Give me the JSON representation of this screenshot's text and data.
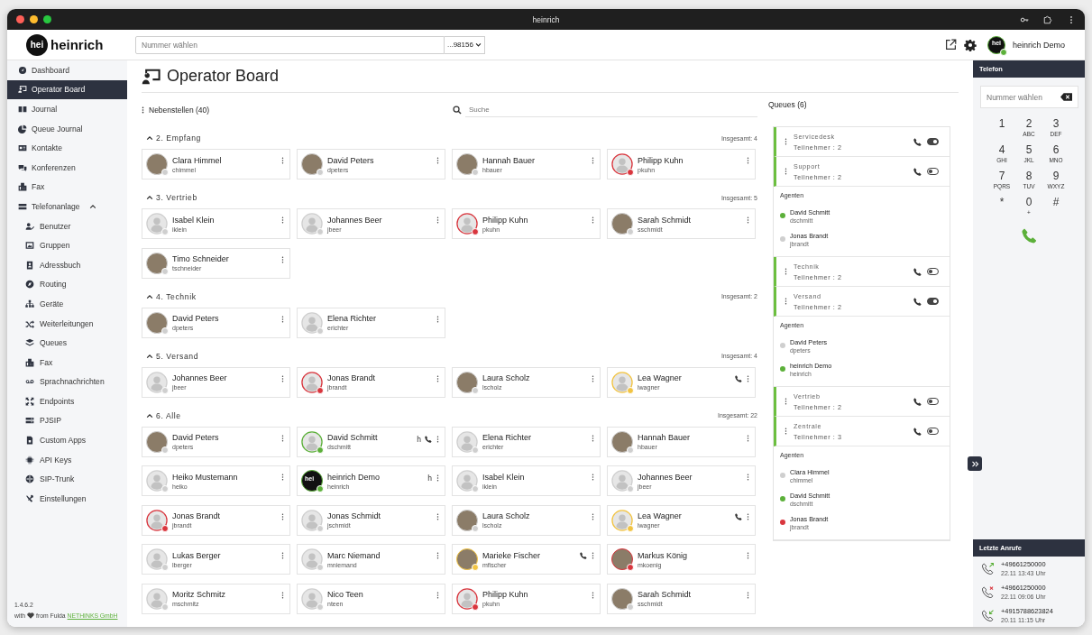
{
  "window": {
    "title": "heinrich"
  },
  "header": {
    "logo_mark": "hei",
    "logo_text": "heinrich",
    "dial_placeholder": "Nummer wählen",
    "caller_id": "...98156",
    "user": {
      "name": "heinrich Demo",
      "avatar_text": "hei",
      "color": "#5cb03a"
    }
  },
  "sidebar": {
    "items": [
      {
        "label": "Dashboard",
        "selected": false
      },
      {
        "label": "Operator Board",
        "selected": true
      },
      {
        "label": "Journal",
        "selected": false
      },
      {
        "label": "Queue Journal",
        "selected": false
      },
      {
        "label": "Kontakte",
        "selected": false
      },
      {
        "label": "Konferenzen",
        "selected": false
      },
      {
        "label": "Fax",
        "selected": false
      },
      {
        "label": "Telefonanlage",
        "selected": false,
        "expanded": true,
        "children": [
          {
            "label": "Benutzer",
            "selected": false
          },
          {
            "label": "Gruppen",
            "selected": false
          },
          {
            "label": "Adressbuch",
            "selected": false
          },
          {
            "label": "Routing",
            "selected": false
          },
          {
            "label": "Geräte",
            "selected": false
          },
          {
            "label": "Weiterleitungen",
            "selected": false
          },
          {
            "label": "Queues",
            "selected": false
          },
          {
            "label": "Fax",
            "selected": false
          },
          {
            "label": "Sprachnachrichten",
            "selected": false
          },
          {
            "label": "Endpoints",
            "selected": false
          },
          {
            "label": "PJSIP",
            "selected": false
          },
          {
            "label": "Custom Apps",
            "selected": false
          },
          {
            "label": "API Keys",
            "selected": false
          },
          {
            "label": "SIP-Trunk",
            "selected": false
          },
          {
            "label": "Einstellungen",
            "selected": false
          }
        ]
      }
    ],
    "version": "1.4.6.2",
    "credit": {
      "before": "with",
      "after": "from Fulda",
      "link": "NETHINKS GmbH"
    }
  },
  "page": {
    "title": "Operator Board"
  },
  "extensions": {
    "title": "Nebenstellen (40)",
    "search_placeholder": "Suche",
    "groups": [
      {
        "title": "2. Empfang",
        "total": "Insgesamt: 4",
        "expanded": true,
        "items": [
          {
            "name": "Clara Himmel",
            "user": "chimmel",
            "kind": "photo",
            "color": "#cfcfcf",
            "calling": false
          },
          {
            "name": "David Peters",
            "user": "dpeters",
            "kind": "photo",
            "color": "#cfcfcf",
            "calling": false
          },
          {
            "name": "Hannah Bauer",
            "user": "hbauer",
            "kind": "photo",
            "color": "#cfcfcf",
            "calling": false
          },
          {
            "name": "Philipp Kuhn",
            "user": "pkuhn",
            "kind": "default",
            "color": "#d9363e",
            "calling": false
          }
        ]
      },
      {
        "title": "3. Vertrieb",
        "total": "Insgesamt: 5",
        "expanded": true,
        "items": [
          {
            "name": "Isabel Klein",
            "user": "iklein",
            "kind": "default",
            "color": "#cfcfcf",
            "calling": false
          },
          {
            "name": "Johannes Beer",
            "user": "jbeer",
            "kind": "default",
            "color": "#cfcfcf",
            "calling": false
          },
          {
            "name": "Philipp Kuhn",
            "user": "pkuhn",
            "kind": "default",
            "color": "#d9363e",
            "calling": false
          },
          {
            "name": "Sarah Schmidt",
            "user": "sschmidt",
            "kind": "photo",
            "color": "#cfcfcf",
            "calling": false
          },
          {
            "name": "Timo Schneider",
            "user": "tschneider",
            "kind": "photo",
            "color": "#cfcfcf",
            "calling": false
          }
        ]
      },
      {
        "title": "4. Technik",
        "total": "Insgesamt: 2",
        "expanded": true,
        "items": [
          {
            "name": "David Peters",
            "user": "dpeters",
            "kind": "photo",
            "color": "#cfcfcf",
            "calling": false
          },
          {
            "name": "Elena Richter",
            "user": "erichter",
            "kind": "default",
            "color": "#cfcfcf",
            "calling": false
          }
        ]
      },
      {
        "title": "5. Versand",
        "total": "Insgesamt: 4",
        "expanded": true,
        "items": [
          {
            "name": "Johannes Beer",
            "user": "jbeer",
            "kind": "default",
            "color": "#cfcfcf",
            "calling": false
          },
          {
            "name": "Jonas Brandt",
            "user": "jbrandt",
            "kind": "default",
            "color": "#d9363e",
            "calling": false
          },
          {
            "name": "Laura Scholz",
            "user": "lscholz",
            "kind": "photo",
            "color": "#cfcfcf",
            "calling": false
          },
          {
            "name": "Lea Wagner",
            "user": "lwagner",
            "kind": "default",
            "color": "#f2c443",
            "calling": true
          }
        ]
      },
      {
        "title": "6. Alle",
        "total": "Insgesamt: 22",
        "expanded": true,
        "items": [
          {
            "name": "David Peters",
            "user": "dpeters",
            "kind": "photo",
            "color": "#cfcfcf",
            "calling": false
          },
          {
            "name": "David Schmitt",
            "user": "dschmitt",
            "kind": "default",
            "color": "#5cb03a",
            "flag": "h",
            "calling": true
          },
          {
            "name": "Elena Richter",
            "user": "erichter",
            "kind": "default",
            "color": "#cfcfcf",
            "calling": false
          },
          {
            "name": "Hannah Bauer",
            "user": "hbauer",
            "kind": "photo",
            "color": "#cfcfcf",
            "calling": false
          },
          {
            "name": "Heiko Mustemann",
            "user": "heiko",
            "kind": "default",
            "color": "#cfcfcf",
            "calling": false
          },
          {
            "name": "heinrich Demo",
            "user": "heinrich",
            "kind": "logo",
            "avatar_text": "hei",
            "color": "#5cb03a",
            "flag": "h",
            "calling": false
          },
          {
            "name": "Isabel Klein",
            "user": "iklein",
            "kind": "default",
            "color": "#cfcfcf",
            "calling": false
          },
          {
            "name": "Johannes Beer",
            "user": "jbeer",
            "kind": "default",
            "color": "#cfcfcf",
            "calling": false
          },
          {
            "name": "Jonas Brandt",
            "user": "jbrandt",
            "kind": "default",
            "color": "#d9363e",
            "calling": false
          },
          {
            "name": "Jonas Schmidt",
            "user": "jschmidt",
            "kind": "default",
            "color": "#cfcfcf",
            "calling": false
          },
          {
            "name": "Laura Scholz",
            "user": "lscholz",
            "kind": "photo",
            "color": "#cfcfcf",
            "calling": false
          },
          {
            "name": "Lea Wagner",
            "user": "lwagner",
            "kind": "default",
            "color": "#f2c443",
            "calling": true
          },
          {
            "name": "Lukas Berger",
            "user": "lberger",
            "kind": "default",
            "color": "#cfcfcf",
            "calling": false
          },
          {
            "name": "Marc Niemand",
            "user": "mniemand",
            "kind": "default",
            "color": "#cfcfcf",
            "calling": false
          },
          {
            "name": "Marieke Fischer",
            "user": "mfischer",
            "kind": "photo",
            "color": "#f2c443",
            "calling": true
          },
          {
            "name": "Markus König",
            "user": "mkoenig",
            "kind": "photo",
            "color": "#d9363e",
            "calling": false
          },
          {
            "name": "Moritz Schmitz",
            "user": "mschmitz",
            "kind": "default",
            "color": "#cfcfcf",
            "calling": false
          },
          {
            "name": "Nico Teen",
            "user": "nteen",
            "kind": "default",
            "color": "#cfcfcf",
            "calling": false
          },
          {
            "name": "Philipp Kuhn",
            "user": "pkuhn",
            "kind": "default",
            "color": "#d9363e",
            "calling": false
          },
          {
            "name": "Sarah Schmidt",
            "user": "sschmidt",
            "kind": "photo",
            "color": "#cfcfcf",
            "calling": false
          }
        ]
      }
    ]
  },
  "queues": {
    "title": "Queues (6)",
    "items": [
      {
        "name": "Servicedesk",
        "members": "Teilnehmer : 2",
        "active": true
      },
      {
        "name": "Support",
        "members": "Teilnehmer : 2",
        "active": false,
        "agents_label": "Agenten",
        "agents": [
          {
            "name": "David Schmitt",
            "user": "dschmitt",
            "color": "#5cb03a"
          },
          {
            "name": "Jonas Brandt",
            "user": "jbrandt",
            "color": "#cfcfcf"
          }
        ]
      },
      {
        "name": "Technik",
        "members": "Teilnehmer : 2",
        "active": false
      },
      {
        "name": "Versand",
        "members": "Teilnehmer : 2",
        "active": true,
        "agents_label": "Agenten",
        "agents": [
          {
            "name": "David Peters",
            "user": "dpeters",
            "color": "#cfcfcf"
          },
          {
            "name": "heinrich Demo",
            "user": "heinrich",
            "color": "#5cb03a"
          }
        ]
      },
      {
        "name": "Vertrieb",
        "members": "Teilnehmer : 2",
        "active": false
      },
      {
        "name": "Zentrale",
        "members": "Teilnehmer : 3",
        "active": false,
        "agents_label": "Agenten",
        "agents": [
          {
            "name": "Clara Himmel",
            "user": "chimmel",
            "color": "#cfcfcf"
          },
          {
            "name": "David Schmitt",
            "user": "dschmitt",
            "color": "#5cb03a"
          },
          {
            "name": "Jonas Brandt",
            "user": "jbrandt",
            "color": "#d9363e"
          }
        ]
      }
    ]
  },
  "phone": {
    "title": "Telefon",
    "placeholder": "Nummer wählen",
    "keys": [
      {
        "digit": "1"
      },
      {
        "digit": "2",
        "letters": "ABC"
      },
      {
        "digit": "3",
        "letters": "DEF"
      },
      {
        "digit": "4",
        "letters": "GHI"
      },
      {
        "digit": "5",
        "letters": "JKL"
      },
      {
        "digit": "6",
        "letters": "MNO"
      },
      {
        "digit": "7",
        "letters": "PQRS"
      },
      {
        "digit": "8",
        "letters": "TUV"
      },
      {
        "digit": "9",
        "letters": "WXYZ"
      },
      {
        "digit": "*"
      },
      {
        "digit": "0",
        "letters": "+"
      },
      {
        "digit": "#"
      }
    ],
    "recent_title": "Letzte Anrufe",
    "recent": [
      {
        "number": "+49661250000",
        "time": "22.11 13:43 Uhr",
        "kind": "outgoing"
      },
      {
        "number": "+49661250000",
        "time": "22.11 09:06 Uhr",
        "kind": "missed"
      },
      {
        "number": "+4915788623824",
        "time": "20.11 11:15 Uhr",
        "kind": "incoming"
      }
    ]
  }
}
